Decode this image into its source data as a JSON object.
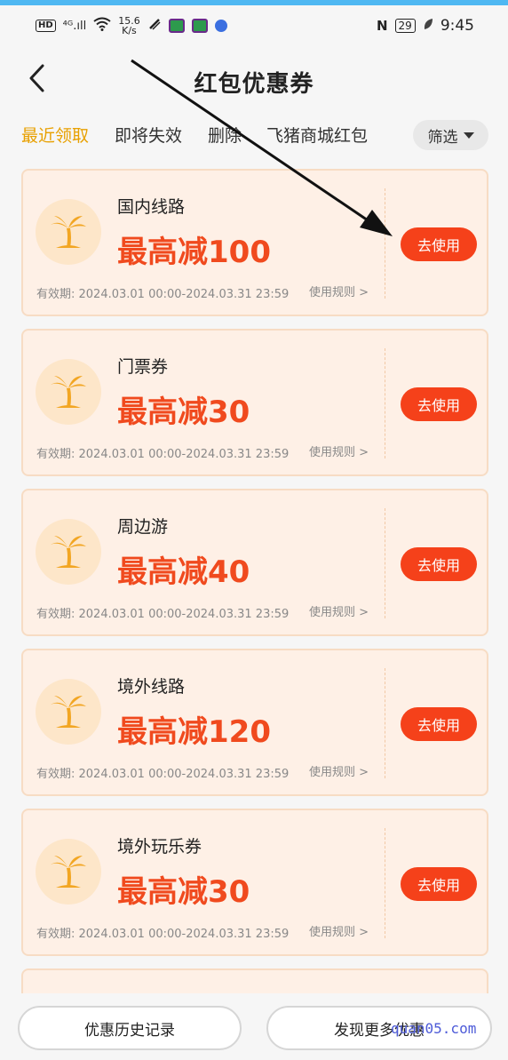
{
  "status_bar": {
    "hd": "HD",
    "signal": "⁴ᴳ.ıll",
    "speed": "15.6",
    "speed_unit": "K/s",
    "nfc": "N",
    "battery": "29",
    "time": "9:45"
  },
  "header": {
    "title": "红包优惠券"
  },
  "tabs": [
    {
      "label": "最近领取",
      "active": true
    },
    {
      "label": "即将失效",
      "active": false
    },
    {
      "label": "删除",
      "active": false
    },
    {
      "label": "飞猪商城红包",
      "active": false
    }
  ],
  "filter": {
    "label": "筛选"
  },
  "coupons": [
    {
      "title": "国内线路",
      "amount": "最高减100",
      "validity": "有效期: 2024.03.01 00:00-2024.03.31 23:59",
      "rules": "使用规则 >",
      "button": "去使用"
    },
    {
      "title": "门票券",
      "amount": "最高减30",
      "validity": "有效期: 2024.03.01 00:00-2024.03.31 23:59",
      "rules": "使用规则 >",
      "button": "去使用"
    },
    {
      "title": "周边游",
      "amount": "最高减40",
      "validity": "有效期: 2024.03.01 00:00-2024.03.31 23:59",
      "rules": "使用规则 >",
      "button": "去使用"
    },
    {
      "title": "境外线路",
      "amount": "最高减120",
      "validity": "有效期: 2024.03.01 00:00-2024.03.31 23:59",
      "rules": "使用规则 >",
      "button": "去使用"
    },
    {
      "title": "境外玩乐券",
      "amount": "最高减30",
      "validity": "有效期: 2024.03.01 00:00-2024.03.31 23:59",
      "rules": "使用规则 >",
      "button": "去使用"
    }
  ],
  "bottom": {
    "history": "优惠历史记录",
    "discover": "发现更多优惠"
  },
  "watermark": "quan05.com",
  "colors": {
    "accent_tab": "#e8a000",
    "amount": "#f04a1e",
    "button": "#f5411a",
    "card_bg": "#fef0e6"
  }
}
